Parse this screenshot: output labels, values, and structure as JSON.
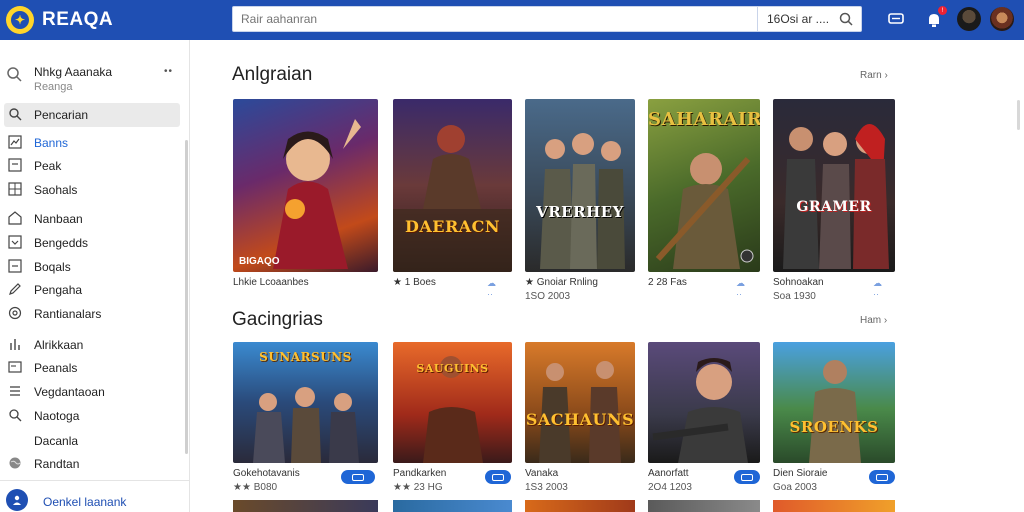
{
  "header": {
    "brand": "REAQA",
    "search_placeholder": "Rair aahanran",
    "search_filter": "16Osi ar ....",
    "notif_badge": "!"
  },
  "sidebar": {
    "profile_name": "Nhkg Aaanaka",
    "profile_sub": "Reanga",
    "profile_menu": "••",
    "items": [
      {
        "label": "Pencarian",
        "icon": "search-icon"
      },
      {
        "label": "Banns",
        "icon": "chart-icon"
      },
      {
        "label": "Peak",
        "icon": "square-icon"
      },
      {
        "label": "Saohals",
        "icon": "grid-icon"
      },
      {
        "label": "Nanbaan",
        "icon": "home-icon"
      },
      {
        "label": "Bengedds",
        "icon": "box-icon"
      },
      {
        "label": "Boqals",
        "icon": "box-icon"
      },
      {
        "label": "Pengaha",
        "icon": "pen-icon"
      },
      {
        "label": "Rantianalars",
        "icon": "location-icon"
      },
      {
        "label": "Alrikkaan",
        "icon": "bars-icon"
      },
      {
        "label": "Peanals",
        "icon": "tablet-icon"
      },
      {
        "label": "Vegdantaoan",
        "icon": "list-icon"
      },
      {
        "label": "Naotoga",
        "icon": "search-icon"
      },
      {
        "label": "Dacanla",
        "icon": "none"
      },
      {
        "label": "Randtan",
        "icon": "globe-icon"
      }
    ],
    "footer_label": "Oenkel laanank"
  },
  "sections": [
    {
      "title": "Anlgraian",
      "more": "Rarn",
      "cards": [
        {
          "title": "",
          "caption": "BIGAQO",
          "label": "Lhkie Lcoaanbes",
          "sub": "",
          "pill": false
        },
        {
          "title": "DAERACN",
          "caption": "",
          "label": "★ 1 Boes",
          "sub": "",
          "pill": false
        },
        {
          "title": "VRERHEY",
          "caption": "",
          "label": "★ Gnoiar Rnling",
          "sub": "1SO 2003",
          "pill": false
        },
        {
          "title": "SAHARAIR",
          "caption": "",
          "label": "2 28 Fas",
          "sub": "",
          "pill": false
        },
        {
          "title": "GRAMER",
          "caption": "",
          "label": "Sohnoakan",
          "sub": "Soa 1930",
          "pill": false
        }
      ]
    },
    {
      "title": "Gacingrias",
      "more": "Ham",
      "cards": [
        {
          "title": "SUNARSUNS",
          "caption": "",
          "label": "Gokehotavanis",
          "sub": "★★ B080",
          "pill": true
        },
        {
          "title": "SAUGUINS",
          "caption": "",
          "label": "Pandkarken",
          "sub": "★★ 23 HG",
          "pill": true
        },
        {
          "title": "SACHAUNS",
          "caption": "",
          "label": "Vanaka",
          "sub": "1S3 2003",
          "pill": true
        },
        {
          "title": "",
          "caption": "",
          "label": "Aanorfatt",
          "sub": "2O4 1203",
          "pill": true
        },
        {
          "title": "SROENKS",
          "caption": "",
          "label": "Dien Sioraie",
          "sub": "Goa 2003",
          "pill": true
        }
      ]
    }
  ],
  "colors": {
    "topbar": "#1f4fb3",
    "accent": "#1f66d6",
    "logo": "#ffd52a"
  }
}
